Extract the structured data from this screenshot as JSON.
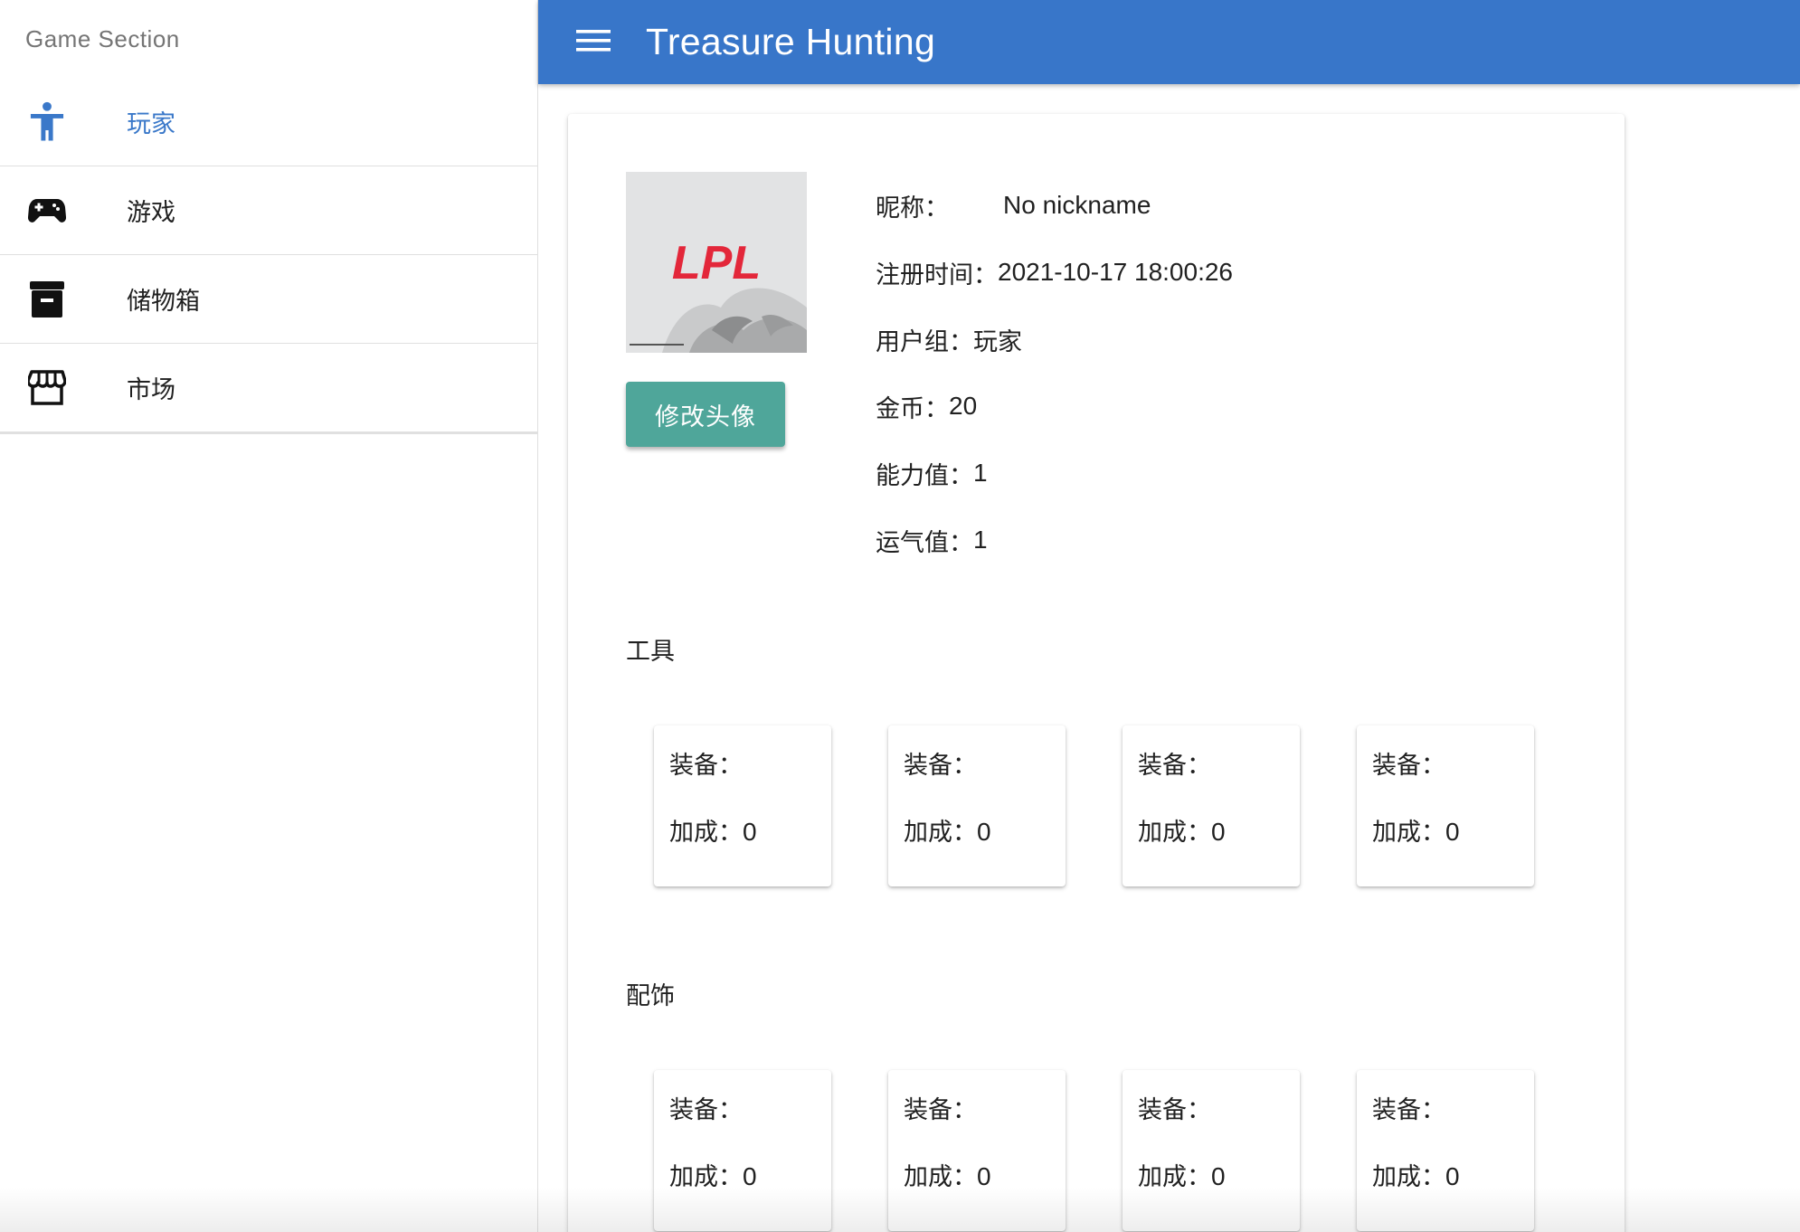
{
  "sidebar": {
    "title": "Game Section",
    "items": [
      {
        "label": "玩家",
        "icon": "accessibility-icon",
        "active": true
      },
      {
        "label": "游戏",
        "icon": "gamepad-icon",
        "active": false
      },
      {
        "label": "储物箱",
        "icon": "archive-icon",
        "active": false
      },
      {
        "label": "市场",
        "icon": "storefront-icon",
        "active": false
      }
    ]
  },
  "header": {
    "title": "Treasure Hunting",
    "menu_icon": "menu-icon"
  },
  "profile": {
    "avatar_logo_text": "LPL",
    "change_avatar_label": "修改头像",
    "nickname_label": "昵称：",
    "nickname": "No nickname",
    "register_label": "注册时间：",
    "register_time": "2021-10-17 18:00:26",
    "group_label": "用户组：",
    "group": "玩家",
    "coins_label": "金币：",
    "coins": "20",
    "ability_label": "能力值：",
    "ability": "1",
    "luck_label": "运气值：",
    "luck": "1"
  },
  "tools": {
    "title": "工具",
    "items": [
      {
        "equip_label": "装备：",
        "bonus_label": "加成：",
        "bonus": "0"
      },
      {
        "equip_label": "装备：",
        "bonus_label": "加成：",
        "bonus": "0"
      },
      {
        "equip_label": "装备：",
        "bonus_label": "加成：",
        "bonus": "0"
      },
      {
        "equip_label": "装备：",
        "bonus_label": "加成：",
        "bonus": "0"
      }
    ]
  },
  "accessories": {
    "title": "配饰",
    "items": [
      {
        "equip_label": "装备：",
        "bonus_label": "加成：",
        "bonus": "0"
      },
      {
        "equip_label": "装备：",
        "bonus_label": "加成：",
        "bonus": "0"
      },
      {
        "equip_label": "装备：",
        "bonus_label": "加成：",
        "bonus": "0"
      },
      {
        "equip_label": "装备：",
        "bonus_label": "加成：",
        "bonus": "0"
      }
    ]
  },
  "colors": {
    "primary": "#3876c9",
    "accent_button": "#4fa69a",
    "active_nav": "#3a78c9",
    "logo_red": "#e3273a"
  }
}
